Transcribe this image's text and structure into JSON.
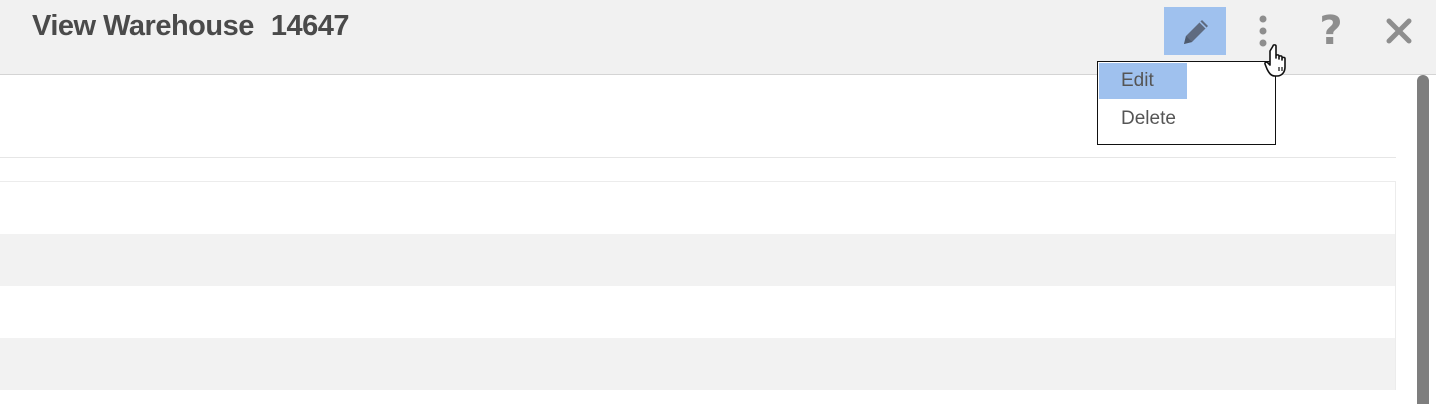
{
  "header": {
    "title": "View Warehouse",
    "warehouse_id": "14647",
    "buttons": {
      "edit": "pencil-icon",
      "more": "vertical-dots-icon",
      "help": "?",
      "close": "close-icon"
    }
  },
  "menu": {
    "items": [
      "Edit",
      "Delete"
    ],
    "highlighted": "Edit"
  },
  "colors": {
    "accent": "#9fc1ee",
    "header_bg": "#f1f1f1",
    "title_text": "#4a4a4a",
    "icon_gray": "#8e8e8e",
    "row_alt": "#f2f2f2"
  }
}
